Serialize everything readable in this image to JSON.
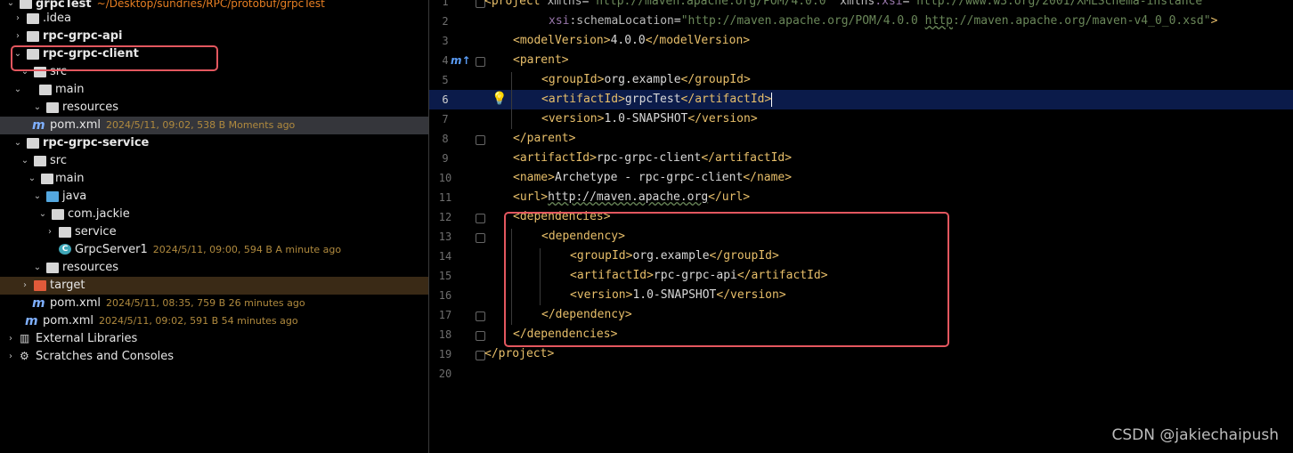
{
  "tree": {
    "root": {
      "label": "grpcTest",
      "path": "~/Desktop/sundries/RPC/protobuf/grpcTest"
    },
    "items": [
      {
        "label": ".idea",
        "meta": ""
      },
      {
        "label": "rpc-grpc-api",
        "meta": ""
      },
      {
        "label": "rpc-grpc-client",
        "meta": ""
      },
      {
        "label": "src",
        "meta": ""
      },
      {
        "label": "main",
        "meta": ""
      },
      {
        "label": "resources",
        "meta": ""
      },
      {
        "label": "pom.xml",
        "meta": "2024/5/11, 09:02, 538 B Moments ago"
      },
      {
        "label": "rpc-grpc-service",
        "meta": ""
      },
      {
        "label": "src",
        "meta": ""
      },
      {
        "label": "main",
        "meta": ""
      },
      {
        "label": "java",
        "meta": ""
      },
      {
        "label": "com.jackie",
        "meta": ""
      },
      {
        "label": "service",
        "meta": ""
      },
      {
        "label": "GrpcServer1",
        "meta": "2024/5/11, 09:00, 594 B A minute ago"
      },
      {
        "label": "resources",
        "meta": ""
      },
      {
        "label": "target",
        "meta": ""
      },
      {
        "label": "pom.xml",
        "meta": "2024/5/11, 08:35, 759 B 26 minutes ago"
      },
      {
        "label": "pom.xml",
        "meta": "2024/5/11, 09:02, 591 B 54 minutes ago"
      },
      {
        "label": "External Libraries",
        "meta": ""
      },
      {
        "label": "Scratches and Consoles",
        "meta": ""
      }
    ]
  },
  "editor": {
    "lines": [
      {
        "n": "1",
        "t1": "<project ",
        "a1": "xmlns",
        "e1": "=",
        "v1": "\"http://maven.apache.org/POM/4.0.0\"",
        "a2": " xmlns",
        "ns2": ":xsi",
        "e2": "=",
        "v2": "\"http://www.w3.org/2001/XMLSchema-instance\""
      },
      {
        "n": "2",
        "ns": "xsi",
        "a": ":schemaLocation",
        "e": "=",
        "v": "\"http://maven.apache.org/POM/4.0.0 ",
        "vu": "http",
        "v2": "://maven.apache.org/maven-v4_0_0.xsd\"",
        "t": ">"
      },
      {
        "n": "3",
        "o": "<modelVersion>",
        "x": "4.0.0",
        "c": "</modelVersion>"
      },
      {
        "n": "4",
        "o": "<parent>"
      },
      {
        "n": "5",
        "o": "<groupId>",
        "x": "org.example",
        "c": "</groupId>"
      },
      {
        "n": "6",
        "o": "<artifactId>",
        "x": "grpcTest",
        "c": "</artifactId>"
      },
      {
        "n": "7",
        "o": "<version>",
        "x": "1.0-SNAPSHOT",
        "c": "</version>"
      },
      {
        "n": "8",
        "o": "</parent>"
      },
      {
        "n": "9",
        "o": "<artifactId>",
        "x": "rpc-grpc-client",
        "c": "</artifactId>"
      },
      {
        "n": "10",
        "o": "<name>",
        "x": "Archetype - rpc-grpc-client",
        "c": "</name>"
      },
      {
        "n": "11",
        "o": "<url>",
        "x": "http://maven.apache.org",
        "c": "</url>"
      },
      {
        "n": "12",
        "o": "<dependencies>"
      },
      {
        "n": "13",
        "o": "<dependency>"
      },
      {
        "n": "14",
        "o": "<groupId>",
        "x": "org.example",
        "c": "</groupId>"
      },
      {
        "n": "15",
        "o": "<artifactId>",
        "x": "rpc-grpc-api",
        "c": "</artifactId>"
      },
      {
        "n": "16",
        "o": "<version>",
        "x": "1.0-SNAPSHOT",
        "c": "</version>"
      },
      {
        "n": "17",
        "o": "</dependency>"
      },
      {
        "n": "18",
        "o": "</dependencies>"
      },
      {
        "n": "19",
        "o": "</project>"
      },
      {
        "n": "20",
        "o": ""
      }
    ],
    "gutter_marker": "m↑"
  },
  "watermark": "CSDN @jakiechaipush",
  "colors": {
    "tag": "#e8bf6a",
    "value": "#6a8759",
    "highlight_box": "#e3575f",
    "current_line": "#0b1b4a"
  }
}
